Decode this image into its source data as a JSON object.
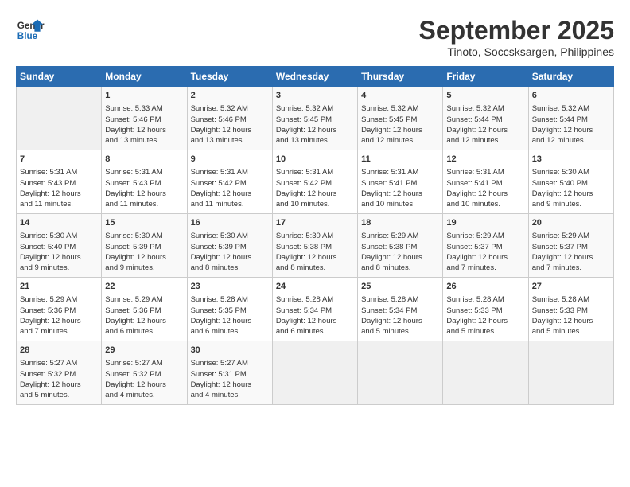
{
  "header": {
    "logo_line1": "General",
    "logo_line2": "Blue",
    "month": "September 2025",
    "location": "Tinoto, Soccsksargen, Philippines"
  },
  "days_of_week": [
    "Sunday",
    "Monday",
    "Tuesday",
    "Wednesday",
    "Thursday",
    "Friday",
    "Saturday"
  ],
  "weeks": [
    [
      {
        "day": "",
        "info": ""
      },
      {
        "day": "1",
        "info": "Sunrise: 5:33 AM\nSunset: 5:46 PM\nDaylight: 12 hours\nand 13 minutes."
      },
      {
        "day": "2",
        "info": "Sunrise: 5:32 AM\nSunset: 5:46 PM\nDaylight: 12 hours\nand 13 minutes."
      },
      {
        "day": "3",
        "info": "Sunrise: 5:32 AM\nSunset: 5:45 PM\nDaylight: 12 hours\nand 13 minutes."
      },
      {
        "day": "4",
        "info": "Sunrise: 5:32 AM\nSunset: 5:45 PM\nDaylight: 12 hours\nand 12 minutes."
      },
      {
        "day": "5",
        "info": "Sunrise: 5:32 AM\nSunset: 5:44 PM\nDaylight: 12 hours\nand 12 minutes."
      },
      {
        "day": "6",
        "info": "Sunrise: 5:32 AM\nSunset: 5:44 PM\nDaylight: 12 hours\nand 12 minutes."
      }
    ],
    [
      {
        "day": "7",
        "info": "Sunrise: 5:31 AM\nSunset: 5:43 PM\nDaylight: 12 hours\nand 11 minutes."
      },
      {
        "day": "8",
        "info": "Sunrise: 5:31 AM\nSunset: 5:43 PM\nDaylight: 12 hours\nand 11 minutes."
      },
      {
        "day": "9",
        "info": "Sunrise: 5:31 AM\nSunset: 5:42 PM\nDaylight: 12 hours\nand 11 minutes."
      },
      {
        "day": "10",
        "info": "Sunrise: 5:31 AM\nSunset: 5:42 PM\nDaylight: 12 hours\nand 10 minutes."
      },
      {
        "day": "11",
        "info": "Sunrise: 5:31 AM\nSunset: 5:41 PM\nDaylight: 12 hours\nand 10 minutes."
      },
      {
        "day": "12",
        "info": "Sunrise: 5:31 AM\nSunset: 5:41 PM\nDaylight: 12 hours\nand 10 minutes."
      },
      {
        "day": "13",
        "info": "Sunrise: 5:30 AM\nSunset: 5:40 PM\nDaylight: 12 hours\nand 9 minutes."
      }
    ],
    [
      {
        "day": "14",
        "info": "Sunrise: 5:30 AM\nSunset: 5:40 PM\nDaylight: 12 hours\nand 9 minutes."
      },
      {
        "day": "15",
        "info": "Sunrise: 5:30 AM\nSunset: 5:39 PM\nDaylight: 12 hours\nand 9 minutes."
      },
      {
        "day": "16",
        "info": "Sunrise: 5:30 AM\nSunset: 5:39 PM\nDaylight: 12 hours\nand 8 minutes."
      },
      {
        "day": "17",
        "info": "Sunrise: 5:30 AM\nSunset: 5:38 PM\nDaylight: 12 hours\nand 8 minutes."
      },
      {
        "day": "18",
        "info": "Sunrise: 5:29 AM\nSunset: 5:38 PM\nDaylight: 12 hours\nand 8 minutes."
      },
      {
        "day": "19",
        "info": "Sunrise: 5:29 AM\nSunset: 5:37 PM\nDaylight: 12 hours\nand 7 minutes."
      },
      {
        "day": "20",
        "info": "Sunrise: 5:29 AM\nSunset: 5:37 PM\nDaylight: 12 hours\nand 7 minutes."
      }
    ],
    [
      {
        "day": "21",
        "info": "Sunrise: 5:29 AM\nSunset: 5:36 PM\nDaylight: 12 hours\nand 7 minutes."
      },
      {
        "day": "22",
        "info": "Sunrise: 5:29 AM\nSunset: 5:36 PM\nDaylight: 12 hours\nand 6 minutes."
      },
      {
        "day": "23",
        "info": "Sunrise: 5:28 AM\nSunset: 5:35 PM\nDaylight: 12 hours\nand 6 minutes."
      },
      {
        "day": "24",
        "info": "Sunrise: 5:28 AM\nSunset: 5:34 PM\nDaylight: 12 hours\nand 6 minutes."
      },
      {
        "day": "25",
        "info": "Sunrise: 5:28 AM\nSunset: 5:34 PM\nDaylight: 12 hours\nand 5 minutes."
      },
      {
        "day": "26",
        "info": "Sunrise: 5:28 AM\nSunset: 5:33 PM\nDaylight: 12 hours\nand 5 minutes."
      },
      {
        "day": "27",
        "info": "Sunrise: 5:28 AM\nSunset: 5:33 PM\nDaylight: 12 hours\nand 5 minutes."
      }
    ],
    [
      {
        "day": "28",
        "info": "Sunrise: 5:27 AM\nSunset: 5:32 PM\nDaylight: 12 hours\nand 5 minutes."
      },
      {
        "day": "29",
        "info": "Sunrise: 5:27 AM\nSunset: 5:32 PM\nDaylight: 12 hours\nand 4 minutes."
      },
      {
        "day": "30",
        "info": "Sunrise: 5:27 AM\nSunset: 5:31 PM\nDaylight: 12 hours\nand 4 minutes."
      },
      {
        "day": "",
        "info": ""
      },
      {
        "day": "",
        "info": ""
      },
      {
        "day": "",
        "info": ""
      },
      {
        "day": "",
        "info": ""
      }
    ]
  ]
}
